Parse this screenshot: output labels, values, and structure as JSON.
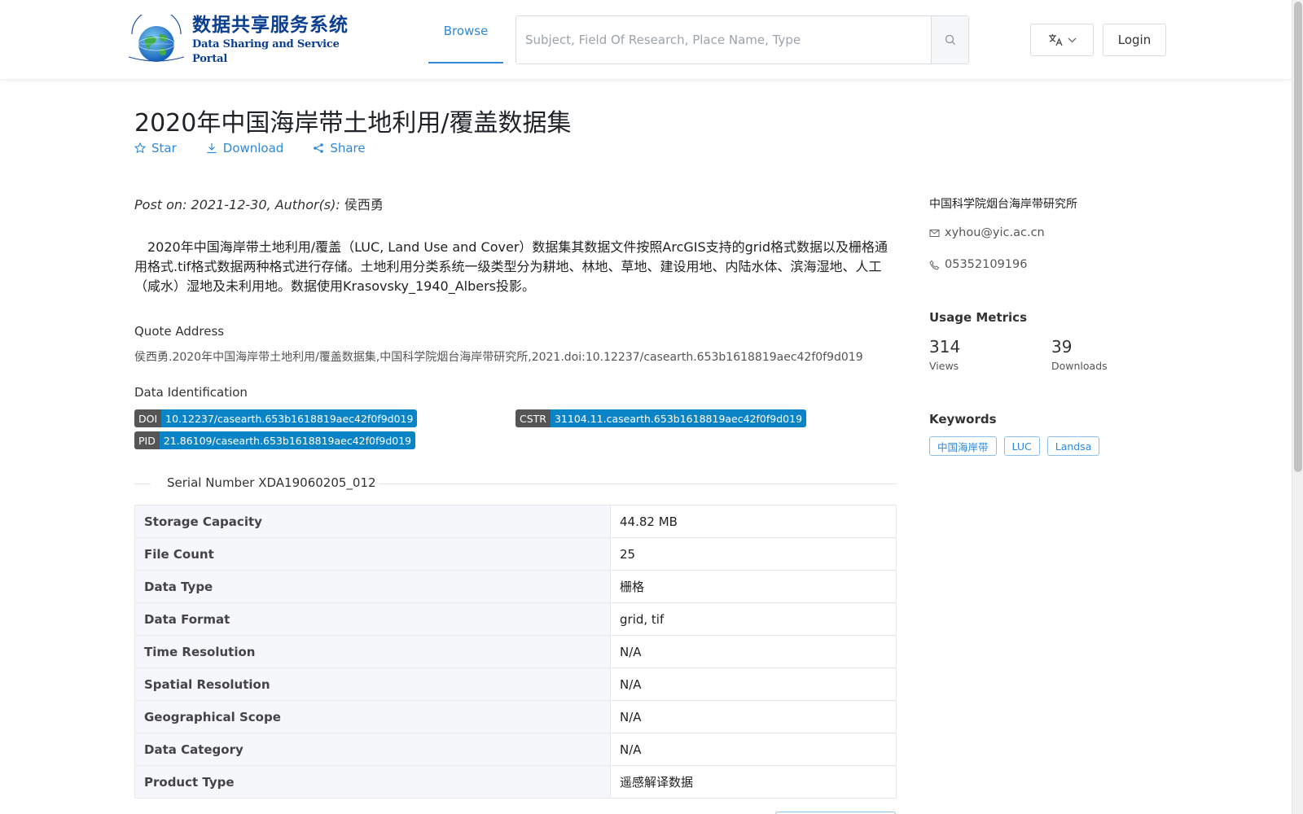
{
  "header": {
    "logo_cn": "数据共享服务系统",
    "logo_en": "Data Sharing and Service Portal",
    "nav_browse": "Browse",
    "search_placeholder": "Subject, Field Of Research, Place Name, Type",
    "login_label": "Login",
    "accent_color": "#2f88d9"
  },
  "dataset": {
    "title": "2020年中国海岸带土地利用/覆盖数据集",
    "actions": {
      "star": "Star",
      "download": "Download",
      "share": "Share"
    },
    "posted_prefix": "Post on: 2021-12-30, Author(s): ",
    "author": "侯西勇",
    "description": "2020年中国海岸带土地利用/覆盖（LUC, Land Use and Cover）数据集其数据文件按照ArcGIS支持的grid格式数据以及栅格通用格式.tif格式数据两种格式进行存储。土地利用分类系统一级类型分为耕地、林地、草地、建设用地、内陆水体、滨海湿地、人工（咸水）湿地及未利用地。数据使用Krasovsky_1940_Albers投影。",
    "quote_label": "Quote Address",
    "quote_text": "侯西勇.2020年中国海岸带土地利用/覆盖数据集,中国科学院烟台海岸带研究所,2021.doi:10.12237/casearth.653b1618819aec42f0f9d019",
    "identification_label": "Data Identification",
    "identifiers": {
      "doi_key": "DOI",
      "doi_value": "10.12237/casearth.653b1618819aec42f0f9d019",
      "cstr_key": "CSTR",
      "cstr_value": "31104.11.casearth.653b1618819aec42f0f9d019",
      "pid_key": "PID",
      "pid_value": "21.86109/casearth.653b1618819aec42f0f9d019"
    },
    "serial": "Serial Number XDA19060205_012",
    "properties": [
      {
        "key": "Storage Capacity",
        "value": "44.82 MB"
      },
      {
        "key": "File Count",
        "value": "25"
      },
      {
        "key": "Data Type",
        "value": "栅格"
      },
      {
        "key": "Data Format",
        "value": "grid, tif"
      },
      {
        "key": "Time Resolution",
        "value": "N/A"
      },
      {
        "key": "Spatial Resolution",
        "value": "N/A"
      },
      {
        "key": "Geographical Scope",
        "value": "N/A"
      },
      {
        "key": "Data Category",
        "value": "N/A"
      },
      {
        "key": "Product Type",
        "value": "遥感解译数据"
      }
    ]
  },
  "sidebar": {
    "organization": "中国科学院烟台海岸带研究所",
    "email": "xyhou@yic.ac.cn",
    "phone": "05352109196",
    "metrics_heading": "Usage Metrics",
    "views_count": "314",
    "views_label": "Views",
    "downloads_count": "39",
    "downloads_label": "Downloads",
    "keywords_heading": "Keywords",
    "keywords": [
      "中国海岸带",
      "LUC",
      "Landsa"
    ]
  }
}
